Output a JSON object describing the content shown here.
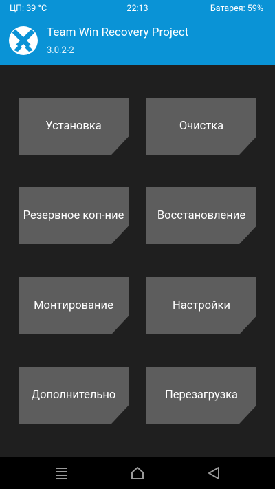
{
  "status": {
    "cpu": "ЦП: 39 °C",
    "time": "22:13",
    "battery": "Батарея: 59%"
  },
  "header": {
    "title": "Team Win Recovery Project",
    "version": "3.0.2-2"
  },
  "buttons": {
    "install": "Установка",
    "wipe": "Очистка",
    "backup": "Резервное коп-ние",
    "restore": "Восстановление",
    "mount": "Монтирование",
    "settings": "Настройки",
    "advanced": "Дополнительно",
    "reboot": "Перезагрузка"
  },
  "nav": {
    "icons": [
      "menu-icon",
      "home-icon",
      "back-icon"
    ]
  },
  "colors": {
    "accent": "#0a93d6",
    "background": "#1f1f1f",
    "button": "#5d5d5d",
    "navbar": "#000000"
  }
}
